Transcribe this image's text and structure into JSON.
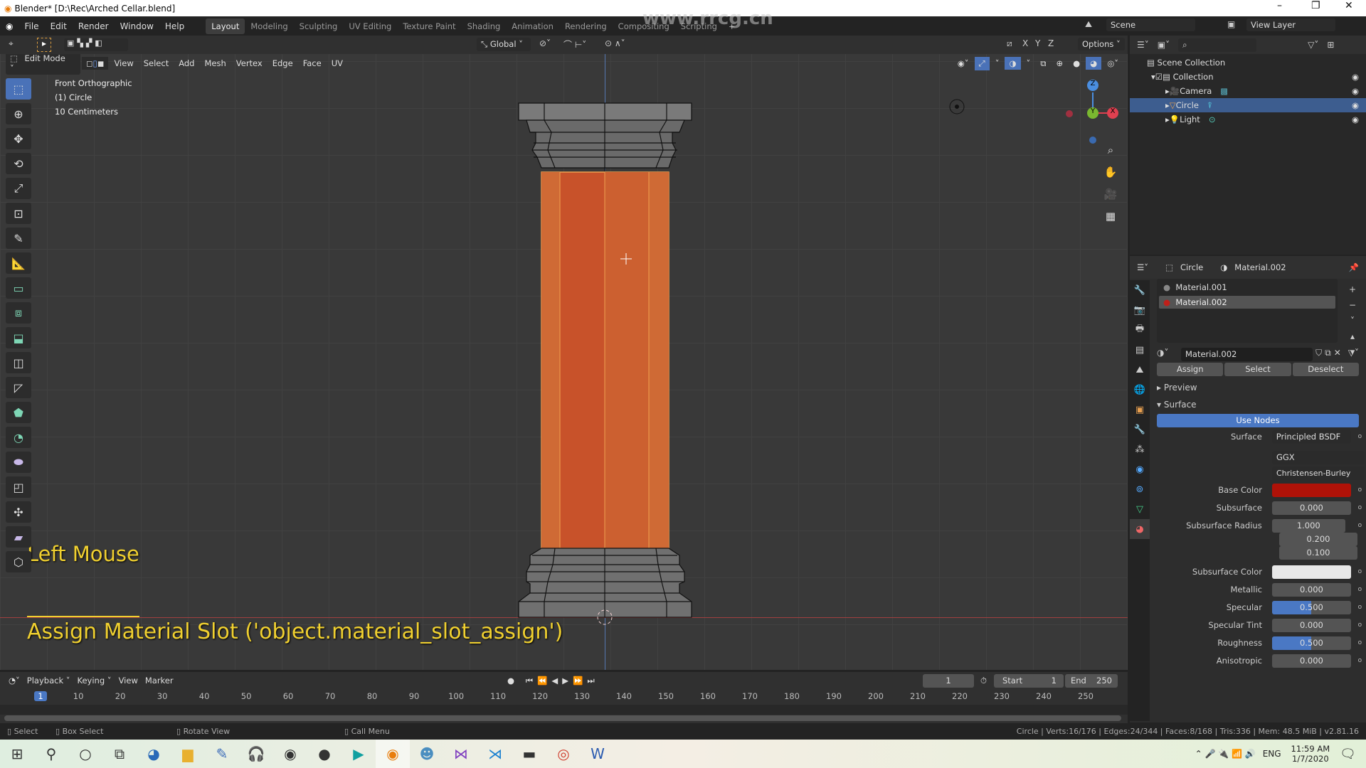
{
  "window": {
    "title": "Blender* [D:\\Rec\\Arched Cellar.blend]",
    "watermark": "www.rrcg.cn"
  },
  "topbar": {
    "menus": [
      "File",
      "Edit",
      "Render",
      "Window",
      "Help"
    ],
    "workspaces": [
      "Layout",
      "Modeling",
      "Sculpting",
      "UV Editing",
      "Texture Paint",
      "Shading",
      "Animation",
      "Rendering",
      "Compositing",
      "Scripting"
    ],
    "active_workspace": "Layout",
    "scene": "Scene",
    "view_layer": "View Layer"
  },
  "tool_header": {
    "orientation": "Global",
    "axes": [
      "X",
      "Y",
      "Z"
    ],
    "options": "Options"
  },
  "viewport_header": {
    "mode": "Edit Mode",
    "menus": [
      "View",
      "Select",
      "Add",
      "Mesh",
      "Vertex",
      "Edge",
      "Face",
      "UV"
    ]
  },
  "viewport": {
    "view_name": "Front Orthographic",
    "object": "(1) Circle",
    "scale": "10 Centimeters",
    "gizmo_axes": [
      "Z",
      "Y",
      "X"
    ],
    "screencast_key": "Left Mouse",
    "operator": "Assign Material Slot ('object.material_slot_assign')",
    "selected_face_color": "#c8522a",
    "caption_color": "#f0d030"
  },
  "toolbar": {
    "tools": [
      "select-box",
      "cursor",
      "move",
      "rotate",
      "scale",
      "transform",
      "annotate",
      "measure",
      "extrude",
      "inset",
      "bevel",
      "loop-cut",
      "knife",
      "poly-build",
      "spin",
      "smooth",
      "edge-slide",
      "shrink-fatten",
      "shear",
      "rip-region"
    ]
  },
  "outliner": {
    "root": "Scene Collection",
    "items": [
      {
        "label": "Collection",
        "level": 1
      },
      {
        "label": "Camera",
        "level": 2,
        "icon": "camera"
      },
      {
        "label": "Circle",
        "level": 2,
        "icon": "mesh",
        "selected": true
      },
      {
        "label": "Light",
        "level": 2,
        "icon": "light"
      }
    ]
  },
  "properties": {
    "object": "Circle",
    "material": "Material.002",
    "slots": [
      {
        "name": "Material.001",
        "color": "#8a8a8a"
      },
      {
        "name": "Material.002",
        "color": "#c0201a",
        "selected": true
      }
    ],
    "material_field": "Material.002",
    "buttons": {
      "assign": "Assign",
      "select": "Select",
      "deselect": "Deselect"
    },
    "panels": {
      "preview": "Preview",
      "surface": "Surface"
    },
    "use_nodes": "Use Nodes",
    "surface_label": "Surface",
    "surface_value": "Principled BSDF",
    "distribution": "GGX",
    "subsurface_method": "Christensen-Burley",
    "base_color_label": "Base Color",
    "base_color": "#b01208",
    "subsurface_label": "Subsurface",
    "subsurface": "0.000",
    "subsurface_radius_label": "Subsurface Radius",
    "subsurface_radius": [
      "1.000",
      "0.200",
      "0.100"
    ],
    "subsurface_color_label": "Subsurface Color",
    "subsurface_color": "#e8e8e8",
    "metallic_label": "Metallic",
    "metallic": "0.000",
    "specular_label": "Specular",
    "specular": "0.500",
    "specular_tint_label": "Specular Tint",
    "specular_tint": "0.000",
    "roughness_label": "Roughness",
    "roughness": "0.500",
    "anisotropic_label": "Anisotropic",
    "anisotropic": "0.000"
  },
  "timeline": {
    "menus": [
      "Playback",
      "Keying",
      "View",
      "Marker"
    ],
    "current_frame": "1",
    "start_label": "Start",
    "start": "1",
    "end_label": "End",
    "end": "250",
    "ticks": [
      1,
      10,
      20,
      30,
      40,
      50,
      60,
      70,
      80,
      90,
      100,
      110,
      120,
      130,
      140,
      150,
      160,
      170,
      180,
      190,
      200,
      210,
      220,
      230,
      240,
      250
    ]
  },
  "statusbar": {
    "select": "Select",
    "box_select": "Box Select",
    "rotate_view": "Rotate View",
    "call_menu": "Call Menu",
    "stats": "Circle | Verts:16/176 | Edges:24/344 | Faces:8/168 | Tris:336 | Mem: 48.5 MiB | v2.81.16"
  },
  "taskbar": {
    "language": "ENG",
    "time": "11:59 AM",
    "date": "1/7/2020"
  }
}
